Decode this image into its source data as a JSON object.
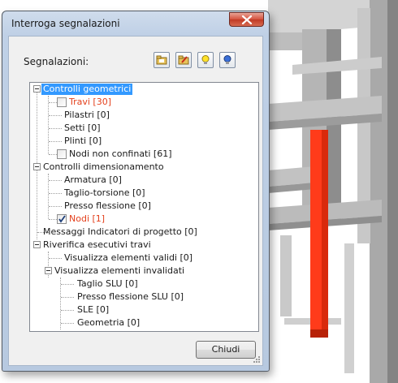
{
  "window": {
    "title": "Interroga segnalazioni",
    "close_icon": "close-icon"
  },
  "toolbar": {
    "label": "Segnalazioni:",
    "buttons": [
      "open-folder-icon",
      "edit-folder-icon",
      "lightbulb-yellow-icon",
      "lightbulb-blue-icon"
    ]
  },
  "tree": {
    "n0": "Controlli geometrici",
    "n1": "Travi [30]",
    "n2": "Pilastri [0]",
    "n3": "Setti [0]",
    "n4": "Plinti [0]",
    "n5": "Nodi non confinati [61]",
    "n6": "Controlli dimensionamento",
    "n7": "Armatura [0]",
    "n8": "Taglio-torsione [0]",
    "n9": "Presso flessione [0]",
    "n10": "Nodi [1]",
    "n11": "Messaggi Indicatori di progetto [0]",
    "n12": "Riverifica esecutivi travi",
    "n13": "Visualizza elementi validi [0]",
    "n14": "Visualizza elementi invalidati",
    "n15": "Taglio SLU [0]",
    "n16": "Presso flessione SLU [0]",
    "n17": "SLE [0]",
    "n18": "Geometria [0]"
  },
  "checked": {
    "travi": false,
    "nodi_non_confinati": false,
    "nodi": true
  },
  "colors": {
    "selection": "#3399ff",
    "warning_text": "#e4401c",
    "highlight_beam": "#ff3b1a"
  },
  "buttons": {
    "close_label": "Chiudi"
  }
}
